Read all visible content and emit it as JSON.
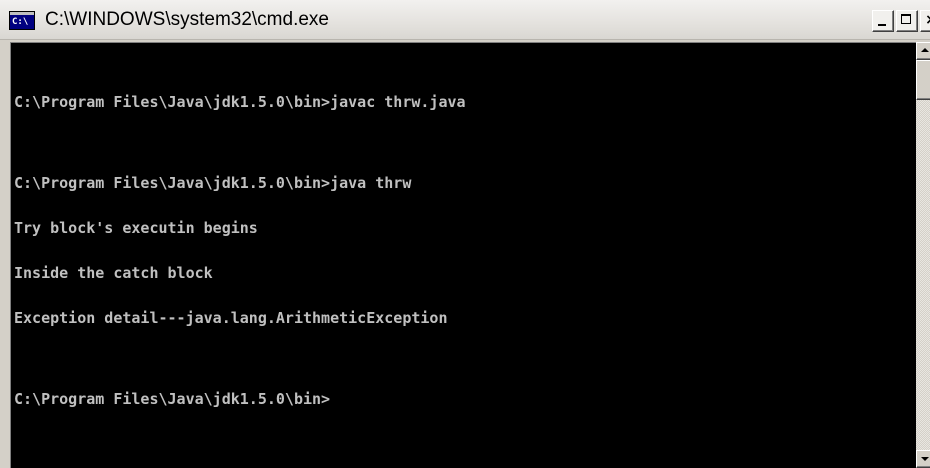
{
  "window": {
    "title": "C:\\WINDOWS\\system32\\cmd.exe",
    "icon": "cmd-icon",
    "icon_text": "C:\\"
  },
  "controls": {
    "minimize": "minimize-icon",
    "maximize": "maximize-icon"
  },
  "console": {
    "lines": [
      "",
      "C:\\Program Files\\Java\\jdk1.5.0\\bin>javac thrw.java",
      "",
      "C:\\Program Files\\Java\\jdk1.5.0\\bin>java thrw",
      "Try block's executin begins",
      "Inside the catch block",
      "Exception detail---java.lang.ArithmeticException",
      "",
      "C:\\Program Files\\Java\\jdk1.5.0\\bin>"
    ]
  },
  "colors": {
    "console_bg": "#000000",
    "console_fg": "#c0c0c0",
    "title_bar": "#e4e2de"
  }
}
